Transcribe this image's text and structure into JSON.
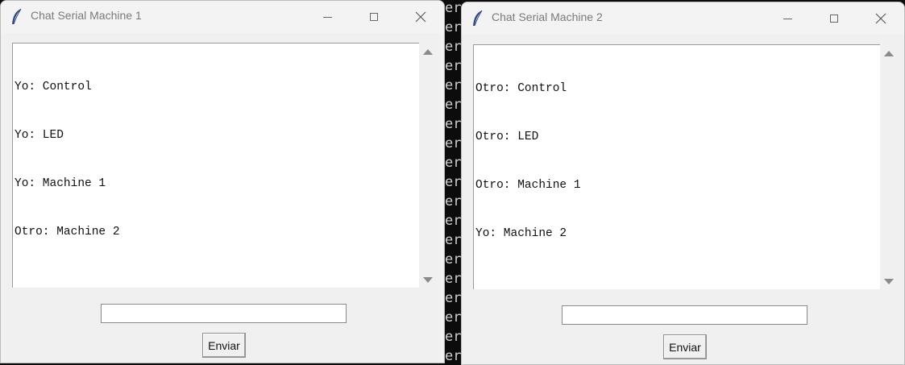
{
  "terminal": {
    "lines": [
      "er",
      "er",
      "er",
      "er",
      "er",
      "er",
      "er",
      "er",
      "er",
      "er",
      "er",
      "er",
      "er",
      "er",
      "er",
      "er",
      "er",
      "er",
      "er"
    ]
  },
  "windows": [
    {
      "title": "Chat Serial Machine 1",
      "messages": [
        "Yo: Control",
        "Yo: LED",
        "Yo: Machine 1",
        "Otro: Machine 2"
      ],
      "entry_value": "",
      "send_label": "Enviar"
    },
    {
      "title": "Chat Serial Machine 2",
      "messages": [
        "Otro: Control",
        "Otro: LED",
        "Otro: Machine 1",
        "Yo: Machine 2"
      ],
      "entry_value": "",
      "send_label": "Enviar"
    }
  ],
  "icons": {
    "app": "feather-icon",
    "minimize": "minimize-icon",
    "maximize": "maximize-icon",
    "close": "close-icon"
  },
  "colors": {
    "terminal_bg": "#0c0c0c",
    "window_bg": "#f0f0f0",
    "text_area_bg": "#ffffff"
  }
}
